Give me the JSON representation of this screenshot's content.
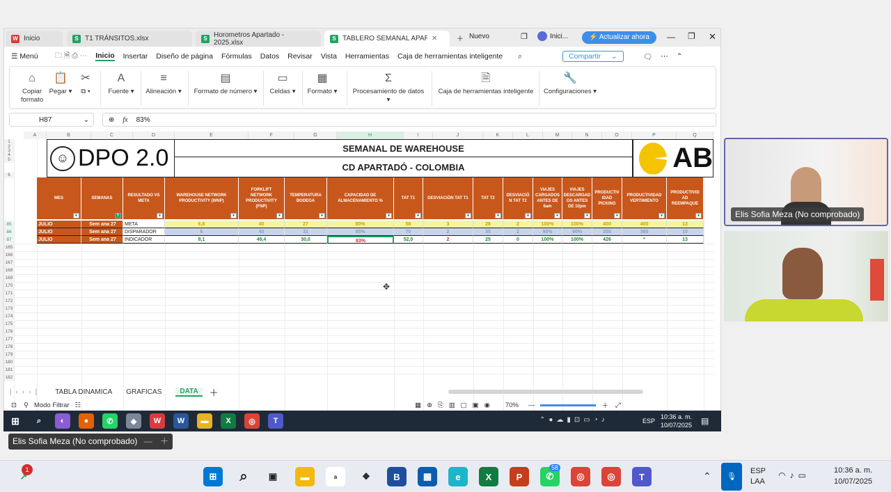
{
  "browser": {
    "tabs": [
      {
        "label": "Inicio",
        "icon": "W",
        "color": "#d83b3b"
      },
      {
        "label": "T1 TRÁNSITOS.xlsx",
        "icon": "S",
        "color": "#21a366"
      },
      {
        "label": "Horometros Apartado - 2025.xlsx",
        "icon": "S",
        "color": "#21a366"
      },
      {
        "label": "TABLERO SEMANAL APARTAD",
        "icon": "S",
        "color": "#21a366"
      }
    ],
    "new_tab": "Nuevo",
    "profile": "Inici...",
    "update": "Actualizar ahora"
  },
  "menu": {
    "menu_label": "Menú",
    "items": [
      "Inicio",
      "Insertar",
      "Diseño de página",
      "Fórmulas",
      "Datos",
      "Revisar",
      "Vista",
      "Herramientas",
      "Caja de herramientas inteligente"
    ],
    "share": "Compartir"
  },
  "ribbon": {
    "copy": "Copiar formato",
    "paste": "Pegar",
    "font": "Fuente",
    "align": "Alineación",
    "numfmt": "Formato de número",
    "cells": "Celdas",
    "format": "Formato",
    "dataproc": "Procesamiento de datos",
    "toolbox": "Caja de herramientas inteligente",
    "config": "Configuraciones"
  },
  "formula": {
    "cell": "H87",
    "fx": "fx",
    "value": "83%"
  },
  "columns": [
    "A",
    "B",
    "C",
    "D",
    "E",
    "F",
    "G",
    "H",
    "I",
    "J",
    "K",
    "L",
    "M",
    "N",
    "O",
    "P",
    "Q"
  ],
  "banner": {
    "logo": "DPO 2.0",
    "title1": "SEMANAL DE WAREHOUSE",
    "title2": "CD APARTADÓ - COLOMBIA",
    "brand": "AB"
  },
  "table": {
    "headers": [
      "MES",
      "SEMANAS",
      "RESULTADO VS META",
      "WAREHOUSE NETWORK PRODUCTIVITY (WNP)",
      "FORKLIFT NETWORK PRODUCTIVITY (FNP)",
      "TEMPERATURA BODEGA",
      "CAPACIDAD DE ALMACENAMIENTO %",
      "TAT T1",
      "DESVIACIÓN TAT T1",
      "TAT T2",
      "DESVIACIÓ N TAT T2",
      "VIAJES CARGADOS ANTES DE 6am",
      "VIAJES DESCARGAD OS ANTES DE 10pm",
      "PRODUCTIV IDAD PICKING",
      "PRODUCTIVIDAD VERTIMIENTO",
      "PRODUCTIVID AD REEMPAQUE"
    ],
    "rows": [
      {
        "num": "85",
        "cells": [
          "JULIO",
          "Sem ana 27",
          "META",
          "6,8",
          "40",
          "27",
          "80%",
          "58",
          "3",
          "28",
          "2",
          "100%",
          "100%",
          "400",
          "400",
          "13"
        ]
      },
      {
        "num": "86",
        "cells": [
          "JULIO",
          "Sem ana 27",
          "DISPARADOR",
          "6",
          "40",
          "31",
          "85%",
          "70",
          "2",
          "35",
          "2",
          "90%",
          "90%",
          "350",
          "380",
          "10"
        ]
      },
      {
        "num": "87",
        "cells": [
          "JULIO",
          "Sem ana 27",
          "INDICADOR",
          "8,1",
          "49,4",
          "30,0",
          "83%",
          "52,0",
          "2",
          "25",
          "0",
          "100%",
          "100%",
          "426",
          "*",
          "13"
        ]
      }
    ],
    "empty_rows": [
      "165",
      "166",
      "167",
      "168",
      "169",
      "170",
      "171",
      "172",
      "173",
      "174",
      "175",
      "176",
      "177",
      "178",
      "179",
      "180",
      "181",
      "182"
    ],
    "top_rows": [
      "1",
      "2",
      "3",
      "4",
      "5",
      "6"
    ]
  },
  "sheets": {
    "tabs": [
      "TABLA DINAMICA",
      "GRAFICAS",
      "DATA"
    ],
    "active": "DATA"
  },
  "status": {
    "mode": "Modo Filtrar",
    "zoom": "70%"
  },
  "inner_taskbar": {
    "lang": "ESP",
    "time": "10:36 a. m.",
    "date": "10/07/2025"
  },
  "meeting": {
    "p1": "Elis Sofia Meza (No comprobado)",
    "bottom_label": "Elis Sofia Meza (No comprobado)"
  },
  "taskbar": {
    "lang1": "ESP",
    "lang2": "LAA",
    "time": "10:36 a. m.",
    "date": "10/07/2025",
    "badge1": "1",
    "badge_whatsapp": "58"
  }
}
